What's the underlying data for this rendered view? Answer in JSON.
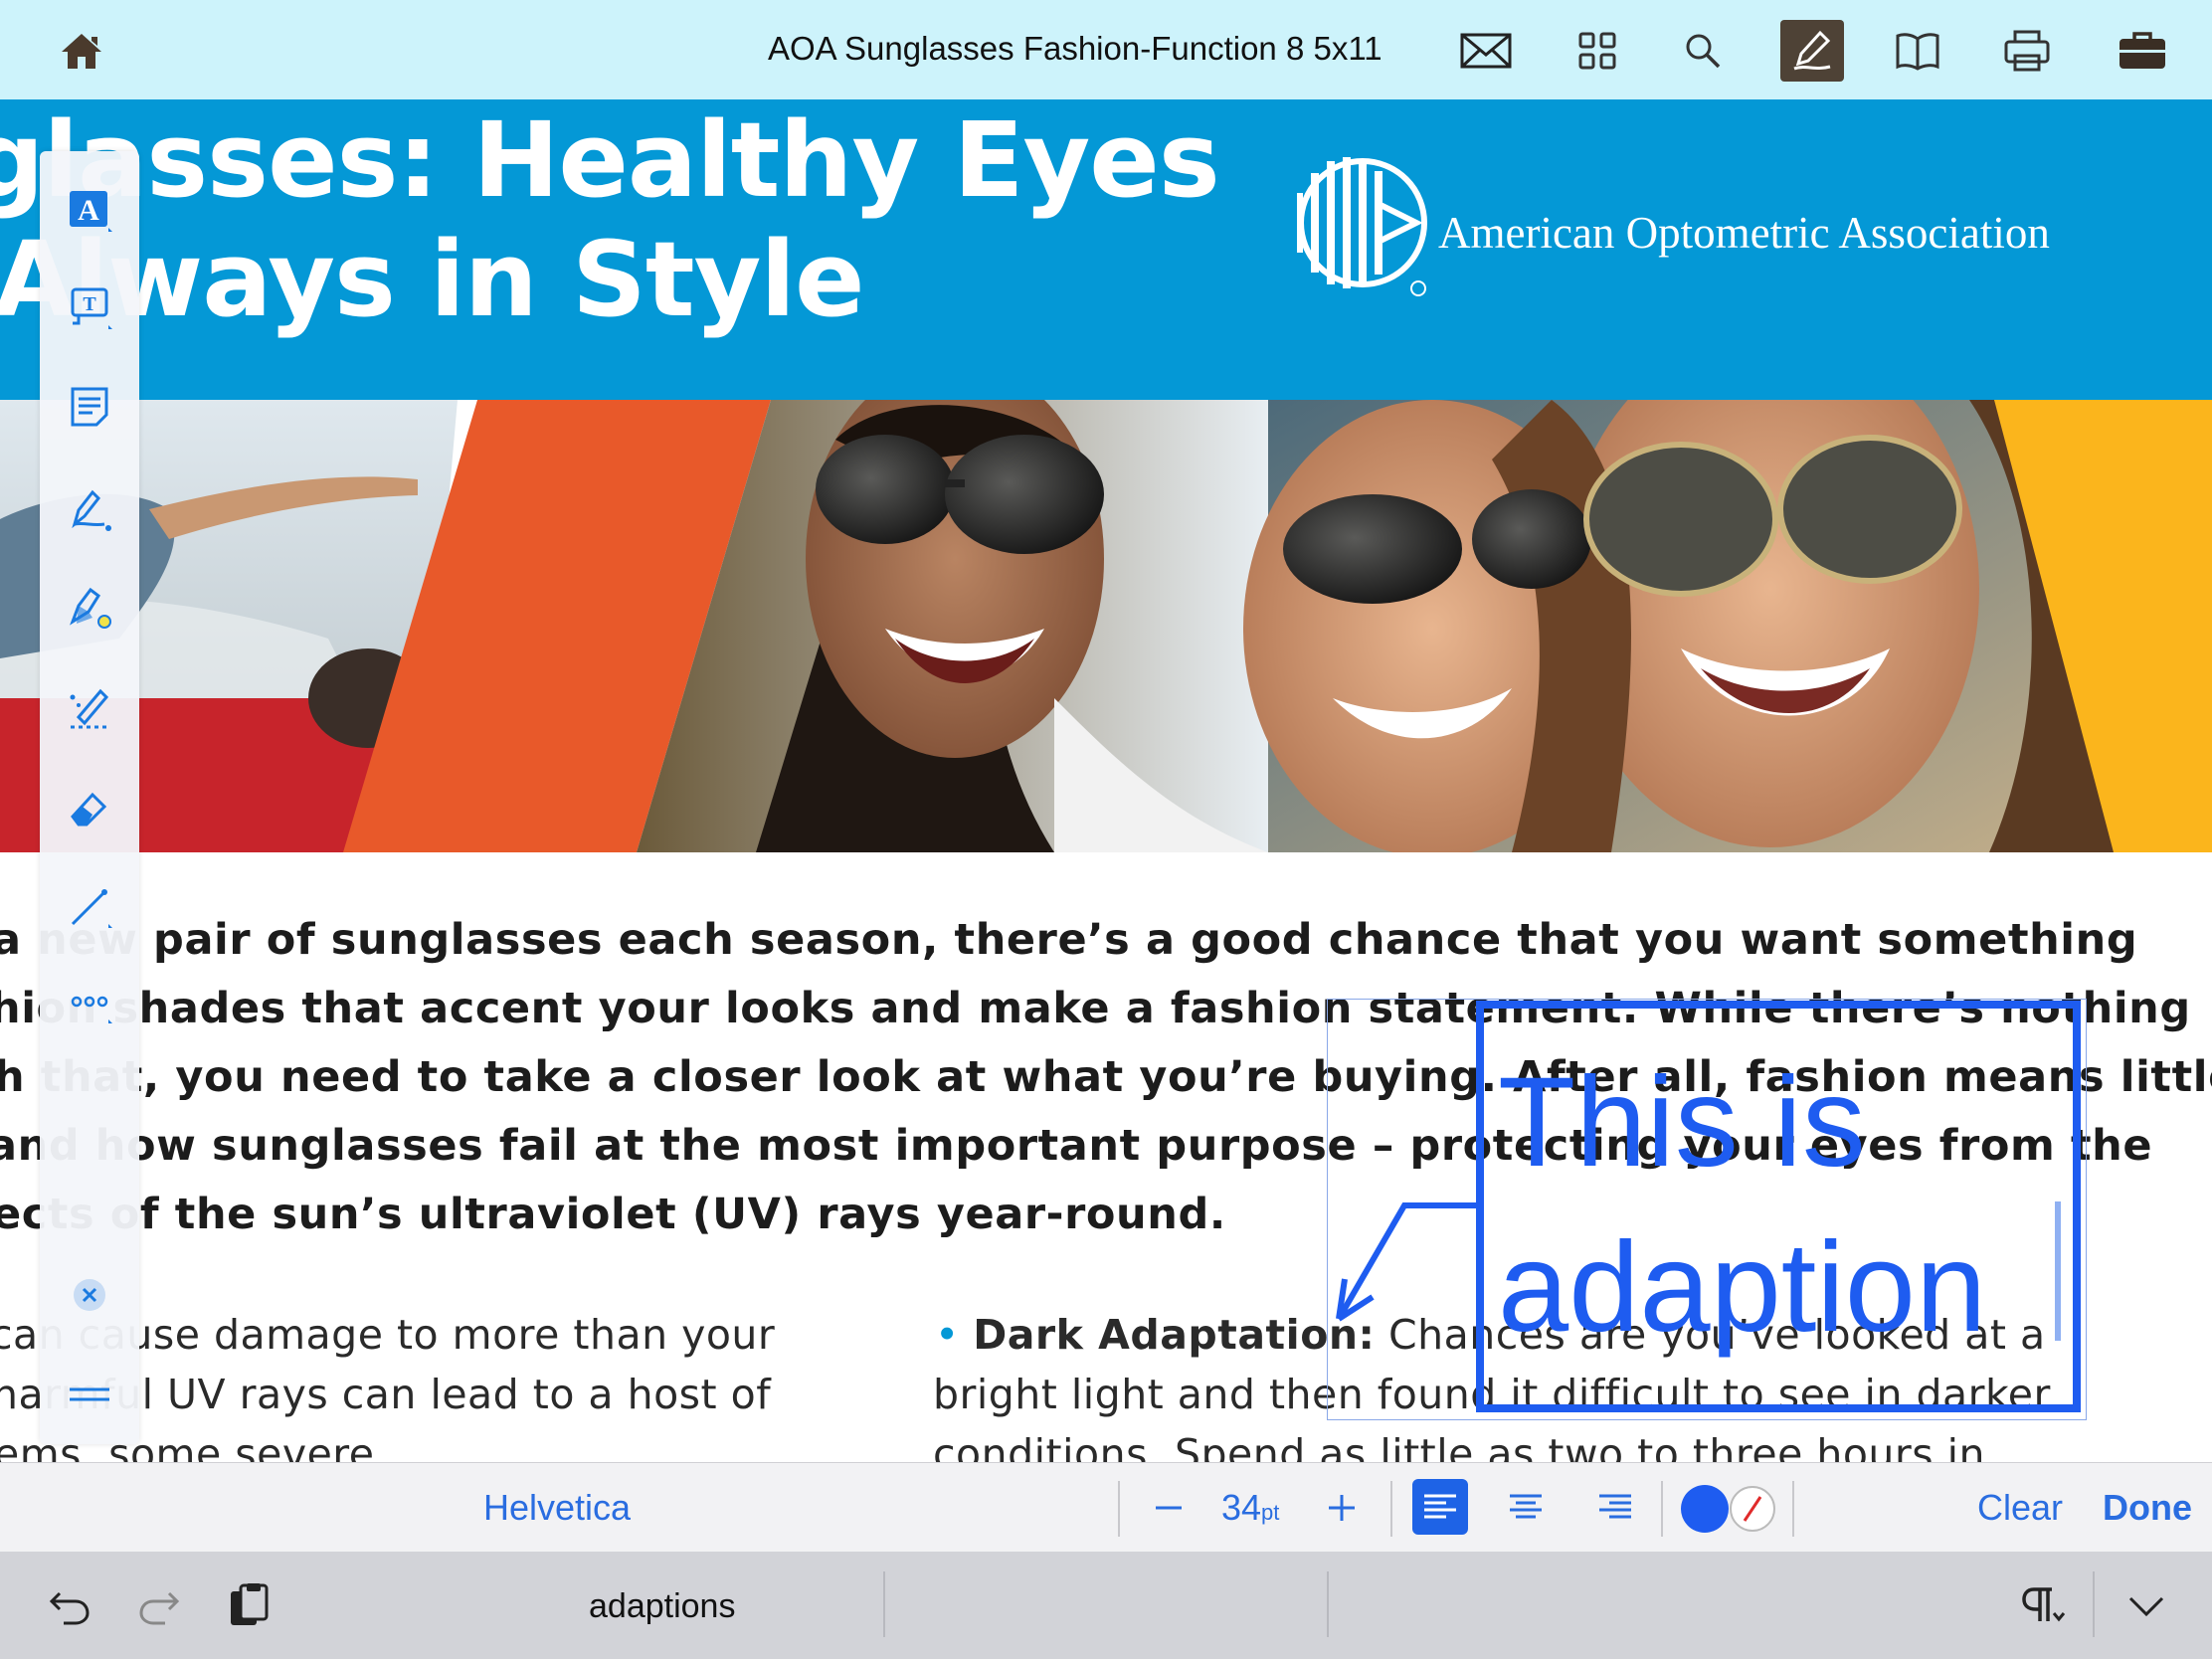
{
  "topbar": {
    "title": "AOA Sunglasses Fashion-Function 8 5x11",
    "icons": [
      "home-icon",
      "mail-icon",
      "grid-icon",
      "search-icon",
      "annotate-pen-icon",
      "book-icon",
      "print-icon",
      "briefcase-icon"
    ],
    "active_color": "#4e4236",
    "bg_color": "#cdf3fb"
  },
  "document": {
    "headline_line1": "glasses: Healthy Eyes",
    "headline_line2": "Always in Style",
    "organization": "American Optometric Association",
    "banner_color": "#0498d6",
    "paragraph_lines": [
      "a new pair of sunglasses each season, there’s a good chance that you want something",
      "hion shades that accent your looks and make a fashion statement. While there’s nothing",
      "h that, you need to take a closer look at what you’re buying. After all, fashion means little",
      "and how sunglasses fail at the most important purpose – protecting your eyes from the",
      "ects of the sun’s ultraviolet (UV) rays year-round."
    ],
    "left_column_lines": [
      "can cause damage to more than your",
      "harmful UV rays can lead to a host of",
      "ems, some severe."
    ],
    "right_bullet_title": "Dark Adaptation:",
    "right_column_lines": [
      "Chances are you’ve looked at a",
      "bright light and then found it difficult to see in darker",
      "conditions. Spend as little as two to three hours in"
    ]
  },
  "annotation": {
    "line1": "This is",
    "line2": "adaption",
    "color": "#1e5cf0"
  },
  "toolbar": {
    "tools": [
      "text-annotation-icon",
      "textbox-icon",
      "note-icon",
      "pen-icon",
      "highlighter-icon",
      "magic-pen-icon",
      "eraser-icon",
      "line-icon",
      "more-icon",
      "close-icon",
      "drag-handle-icon"
    ],
    "icon_color": "#1a7ae0"
  },
  "format_bar": {
    "font_name": "Helvetica",
    "font_size": "34",
    "font_unit": "pt",
    "clear_label": "Clear",
    "done_label": "Done",
    "text_color": "#1e5cf0",
    "accent": "#2a6de0"
  },
  "keyboard_bar": {
    "suggestion": "adaptions"
  }
}
